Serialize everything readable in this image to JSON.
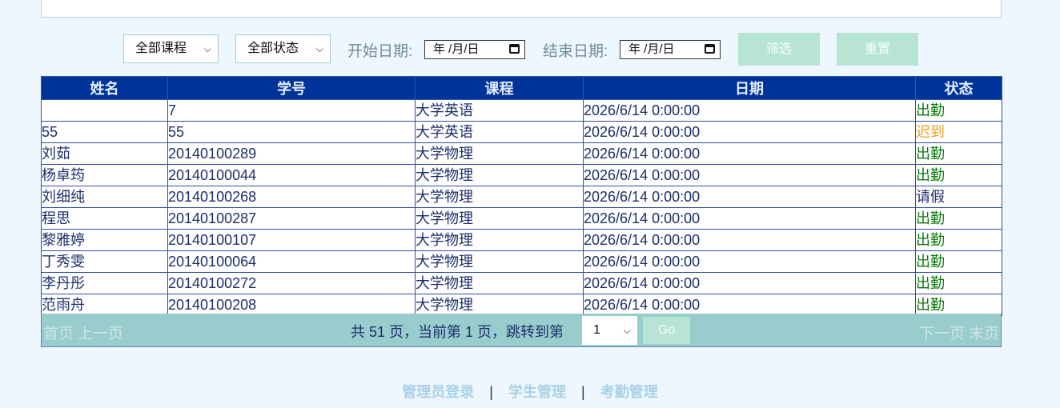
{
  "filters": {
    "course_select": "全部课程",
    "status_select": "全部状态",
    "start_label": "开始日期:",
    "start_value": "年 /月/日",
    "end_label": "结束日期:",
    "end_value": "年 /月/日",
    "filter_button": "筛选",
    "reset_button": "重置"
  },
  "table": {
    "headers": [
      "姓名",
      "学号",
      "课程",
      "日期",
      "状态"
    ],
    "rows": [
      [
        "",
        "7",
        "大学英语",
        "2026/6/14 0:00:00",
        "出勤"
      ],
      [
        "55",
        "55",
        "大学英语",
        "2026/6/14 0:00:00",
        "迟到"
      ],
      [
        "刘茹",
        "20140100289",
        "大学物理",
        "2026/6/14 0:00:00",
        "出勤"
      ],
      [
        "杨卓筠",
        "20140100044",
        "大学物理",
        "2026/6/14 0:00:00",
        "出勤"
      ],
      [
        "刘细纯",
        "20140100268",
        "大学物理",
        "2026/6/14 0:00:00",
        "请假"
      ],
      [
        "程思",
        "20140100287",
        "大学物理",
        "2026/6/14 0:00:00",
        "出勤"
      ],
      [
        "黎雅婷",
        "20140100107",
        "大学物理",
        "2026/6/14 0:00:00",
        "出勤"
      ],
      [
        "丁秀雯",
        "20140100064",
        "大学物理",
        "2026/6/14 0:00:00",
        "出勤"
      ],
      [
        "李丹彤",
        "20140100272",
        "大学物理",
        "2026/6/14 0:00:00",
        "出勤"
      ],
      [
        "范雨舟",
        "20140100208",
        "大学物理",
        "2026/6/14 0:00:00",
        "出勤"
      ]
    ]
  },
  "pager": {
    "first": "首页",
    "prev": "上一页",
    "info": "共 51 页，当前第 1 页，跳转到第",
    "page_select": "1",
    "go": "Go",
    "next": "下一页",
    "last": "末页"
  },
  "footer": {
    "links": [
      "管理员登录",
      "学生管理",
      "考勤管理"
    ],
    "separator": "|"
  },
  "colors": {
    "header_bg": "#003399",
    "pager_bg": "#99cccc",
    "button_bg": "#b7e4d3",
    "present": "#0d7a0d",
    "late": "#f0a020",
    "leave": "#1c2f6b"
  }
}
